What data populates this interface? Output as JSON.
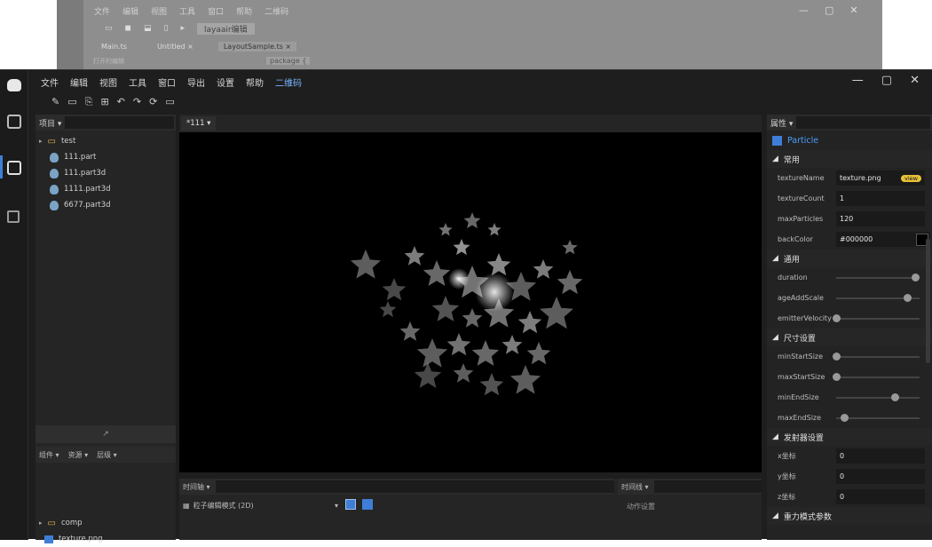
{
  "bg": {
    "menu": [
      "文件",
      "编辑",
      "视图",
      "工具",
      "窗口",
      "帮助",
      "二维码"
    ],
    "toolbar_field": "layaair编辑",
    "tabs": [
      "Main.ts",
      "Untitled ×",
      "LayoutSample.ts ×"
    ],
    "winctl": [
      "—",
      "▢",
      "✕"
    ],
    "badge": "打开的编辑",
    "extra": "package {"
  },
  "menubar": {
    "items": [
      "文件",
      "编辑",
      "视图",
      "工具",
      "窗口",
      "导出",
      "设置",
      "帮助",
      "二维码"
    ],
    "winctl": [
      "—",
      "▢",
      "✕"
    ]
  },
  "toolbar": {
    "icons": [
      "✎",
      "▭",
      "⎘",
      "⊞",
      "↶",
      "↷",
      "⟳",
      "▭"
    ]
  },
  "rail": {
    "icons": [
      "logo-icon",
      "code-icon",
      "edit-icon",
      "layers-icon"
    ]
  },
  "left": {
    "head_title": "项目 ▾",
    "tree": {
      "folder": "test",
      "files": [
        "111.part",
        "111.part3d",
        "1111.part3d",
        "6677.part3d"
      ]
    },
    "mid_tabs": [
      "组件 ▾",
      "资源 ▾",
      "层级 ▾"
    ],
    "bottom": {
      "folder": "comp",
      "file": "texture.png"
    }
  },
  "center": {
    "tab": "*111 ▾",
    "bottom_left_head": "时间轴 ▾",
    "bottom_left_field": "粒子编辑模式 (2D)",
    "bottom_right_head": "时间线 ▾",
    "bottom_right_field": "动作设置"
  },
  "right": {
    "head": "属性 ▾",
    "title": "Particle",
    "sections": {
      "basic": "常用",
      "general": "通用",
      "size": "尺寸设置",
      "emit": "发射器设置",
      "gravity": "重力模式参数"
    },
    "props": {
      "textureName": {
        "label": "textureName",
        "value": "texture.png",
        "badge": "view"
      },
      "textureCount": {
        "label": "textureCount",
        "value": "1"
      },
      "maxParticles": {
        "label": "maxParticles",
        "value": "120"
      },
      "backColor": {
        "label": "backColor",
        "value": "#000000"
      },
      "duration": {
        "label": "duration",
        "level": 0.95
      },
      "ageAddScale": {
        "label": "ageAddScale",
        "level": 0.85
      },
      "emitterVelocity": {
        "label": "emitterVelocity",
        "level": 0.0
      },
      "minStartSize": {
        "label": "minStartSize",
        "level": 0.0
      },
      "maxStartSize": {
        "label": "maxStartSize",
        "level": 0.0
      },
      "minEndSize": {
        "label": "minEndSize",
        "level": 0.7
      },
      "maxEndSize": {
        "label": "maxEndSize",
        "level": 0.1
      },
      "x": {
        "label": "x坐标",
        "value": "0"
      },
      "y": {
        "label": "y坐标",
        "value": "0"
      },
      "z": {
        "label": "z坐标",
        "value": "0"
      }
    }
  },
  "colors": {
    "accent": "#3f7ed6",
    "folder": "#e8b34a",
    "badge": "#e6c13a"
  }
}
